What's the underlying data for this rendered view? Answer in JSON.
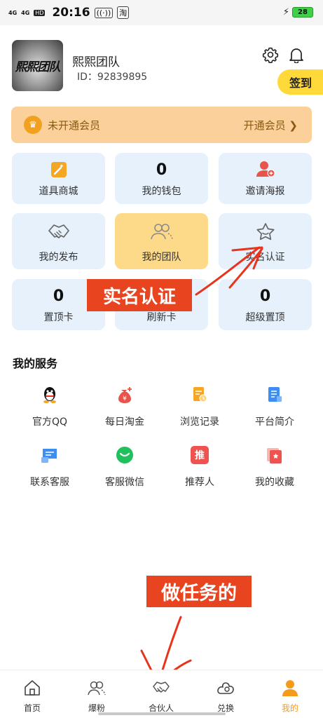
{
  "status_bar": {
    "network1": "4G",
    "network2": "4G",
    "hd": "HD",
    "time": "20:16",
    "battery": "28"
  },
  "profile": {
    "avatar_text": "熙熙团队",
    "name": "熙熙团队",
    "id": "ID：92839895",
    "signin_label": "签到"
  },
  "member": {
    "status": "未开通会员",
    "open_label": "开通会员 ❯"
  },
  "grid": {
    "tools": {
      "label": "道具商城"
    },
    "wallet": {
      "value": "0",
      "label": "我的钱包"
    },
    "invite": {
      "label": "邀请海报"
    },
    "publish": {
      "label": "我的发布"
    },
    "team": {
      "label": "我的团队"
    },
    "verify": {
      "label": "实名认证"
    },
    "top_card": {
      "value": "0",
      "label": "置顶卡"
    },
    "refresh_card": {
      "label": "刷新卡"
    },
    "super_top": {
      "value": "0",
      "label": "超级置顶"
    }
  },
  "services": {
    "title": "我的服务",
    "items": [
      {
        "label": "官方QQ",
        "icon": "qq-icon"
      },
      {
        "label": "每日淘金",
        "icon": "money-bag-icon"
      },
      {
        "label": "浏览记录",
        "icon": "history-icon"
      },
      {
        "label": "平台简介",
        "icon": "info-doc-icon"
      },
      {
        "label": "联系客服",
        "icon": "chat-icon"
      },
      {
        "label": "客服微信",
        "icon": "wechat-icon"
      },
      {
        "label": "推荐人",
        "icon": "referrer-icon",
        "glyph": "推"
      },
      {
        "label": "我的收藏",
        "icon": "favorite-icon"
      }
    ]
  },
  "annotations": {
    "verify": "实名认证",
    "task": "做任务的"
  },
  "nav": {
    "items": [
      {
        "label": "首页",
        "icon": "home-icon"
      },
      {
        "label": "爆粉",
        "icon": "fans-icon"
      },
      {
        "label": "合伙人",
        "icon": "handshake-icon"
      },
      {
        "label": "兑换",
        "icon": "exchange-icon"
      },
      {
        "label": "我的",
        "icon": "profile-icon"
      }
    ],
    "active_color": "#f59a1b"
  },
  "colors": {
    "signin": "#ffd83a",
    "member_bar": "#fbd09a",
    "card": "#e6f1fc",
    "card_active": "#fdd98a",
    "annotation": "#e84420"
  }
}
